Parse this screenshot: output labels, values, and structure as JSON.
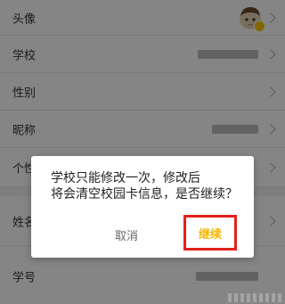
{
  "profile": {
    "rows": [
      {
        "label": "头像",
        "kind": "avatar"
      },
      {
        "label": "学校",
        "kind": "value",
        "value_width": 68
      },
      {
        "label": "性别",
        "kind": "value",
        "value_width": 0
      },
      {
        "label": "昵称",
        "kind": "value",
        "value_width": 52
      },
      {
        "label": "个性签名",
        "kind": "value",
        "value_width": 0
      },
      {
        "label": "姓名",
        "kind": "value",
        "value_width": 0
      },
      {
        "label": "学号",
        "kind": "value",
        "value_width": 70
      }
    ]
  },
  "dialog": {
    "message_line1": "学校只能修改一次，修改后",
    "message_line2": "将会清空校园卡信息，是否继续？",
    "cancel_label": "取消",
    "continue_label": "继续"
  },
  "colors": {
    "highlight_border": "#e3211b",
    "continue_text": "#f7b500",
    "overlay": "rgba(0,0,0,0.48)"
  }
}
